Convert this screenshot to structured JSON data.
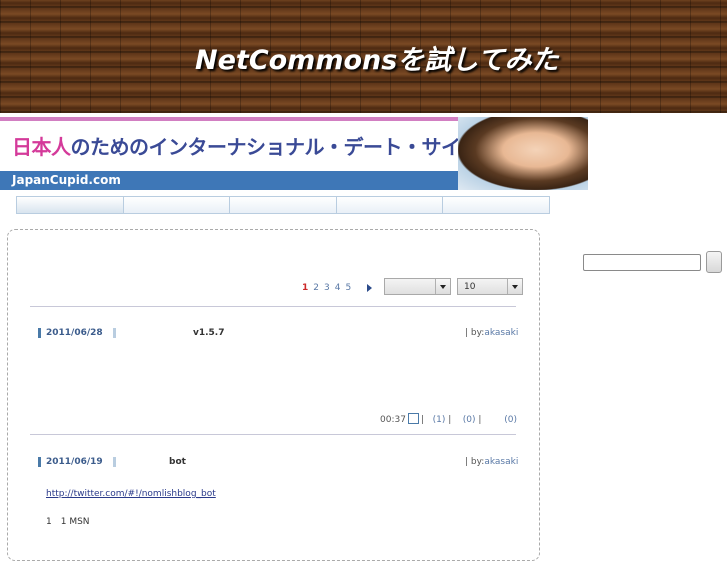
{
  "header": {
    "title": "NetCommonsを試してみた"
  },
  "banner": {
    "text_pink": "日本人",
    "text_rest": "のためのインターナショナル・デート・サイト!",
    "domain": "JapanCupid.com",
    "info_icon": "info-icon"
  },
  "menu": {
    "items": [
      "",
      "",
      "",
      "",
      ""
    ]
  },
  "pager": {
    "pages": [
      "1",
      "2",
      "3",
      "4",
      "5"
    ],
    "current": "1",
    "next_icon": "triangle-right-icon"
  },
  "category_select": {
    "value": ""
  },
  "count_select": {
    "value": "10"
  },
  "posts": [
    {
      "date": "2011/06/28",
      "title": "v1.5.7",
      "by_prefix": "| by:",
      "author": "akasaki",
      "footer": {
        "time": "00:37",
        "sep1": "|",
        "count1": "(1)",
        "sep2": "|",
        "count2": "(0)",
        "sep3": "|",
        "count3": "(0)"
      }
    },
    {
      "date": "2011/06/19",
      "title": "bot",
      "by_prefix": "| by:",
      "author": "akasaki",
      "link": "http://twitter.com/#!/nomlishblog_bot",
      "body": "1　1  MSN"
    }
  ],
  "search": {
    "value": "",
    "button_label": ""
  }
}
